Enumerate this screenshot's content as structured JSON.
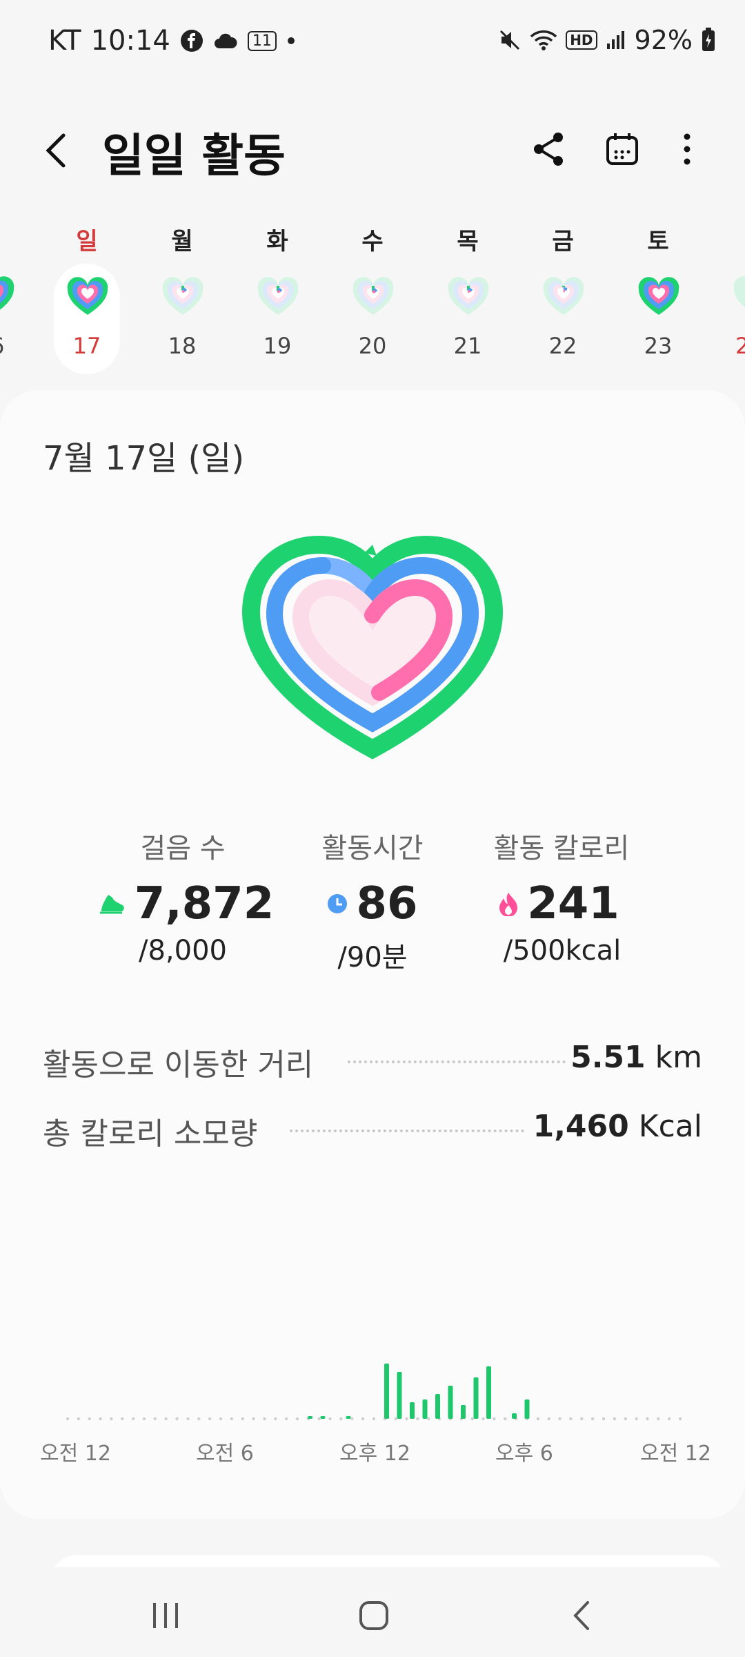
{
  "status_bar": {
    "carrier": "KT",
    "time": "10:14",
    "temperature_badge": "11",
    "battery": "92%",
    "icons": [
      "facebook-icon",
      "cloud-icon",
      "temperature-icon",
      "notification-dot-icon",
      "mute-icon",
      "wifi-icon",
      "hd-voice-icon",
      "signal-icon",
      "battery-charging-icon"
    ]
  },
  "header": {
    "title": "일일 활동",
    "actions": [
      "share-icon",
      "calendar-icon",
      "more-icon"
    ]
  },
  "week": {
    "days": [
      {
        "weekday": "일",
        "date": "17",
        "selected": true,
        "progress": 1.0
      },
      {
        "weekday": "월",
        "date": "18",
        "selected": false,
        "progress": 0.3
      },
      {
        "weekday": "화",
        "date": "19",
        "selected": false,
        "progress": 0.35
      },
      {
        "weekday": "수",
        "date": "20",
        "selected": false,
        "progress": 0.4
      },
      {
        "weekday": "목",
        "date": "21",
        "selected": false,
        "progress": 0.3
      },
      {
        "weekday": "금",
        "date": "22",
        "selected": false,
        "progress": 0.1
      },
      {
        "weekday": "토",
        "date": "23",
        "selected": false,
        "progress": 1.0
      }
    ],
    "prev_partial_date": "6",
    "next_partial_date": "2"
  },
  "card": {
    "date": "7월 17일 (일)",
    "colors": {
      "steps": "#1ed36f",
      "active_time": "#4f9cf5",
      "calories": "#ff6fae"
    },
    "stats": [
      {
        "label": "걸음 수",
        "value": "7,872",
        "goal": "/8,000",
        "icon": "shoe-icon",
        "progress": 0.984
      },
      {
        "label": "활동시간",
        "value": "86",
        "goal": "/90분",
        "icon": "clock-icon",
        "progress": 0.956
      },
      {
        "label": "활동 칼로리",
        "value": "241",
        "goal": "/500kcal",
        "icon": "flame-icon",
        "progress": 0.482
      }
    ],
    "metrics": [
      {
        "label": "활동으로 이동한 거리",
        "value": "5.51",
        "unit": "km"
      },
      {
        "label": "총 칼로리 소모량",
        "value": "1,460",
        "unit": "Kcal"
      }
    ]
  },
  "chart_data": {
    "type": "bar",
    "title": "",
    "xlabel": "",
    "ylabel": "",
    "x_ticks": [
      "오전 12",
      "오전 6",
      "오후 12",
      "오후 6",
      "오전 12"
    ],
    "bars": [
      {
        "hour": 9.5,
        "value": 0.05
      },
      {
        "hour": 10.0,
        "value": 0.05
      },
      {
        "hour": 11.0,
        "value": 0.05
      },
      {
        "hour": 12.5,
        "value": 1.0
      },
      {
        "hour": 13.0,
        "value": 0.85
      },
      {
        "hour": 13.5,
        "value": 0.3
      },
      {
        "hour": 14.0,
        "value": 0.35
      },
      {
        "hour": 14.5,
        "value": 0.45
      },
      {
        "hour": 15.0,
        "value": 0.6
      },
      {
        "hour": 15.5,
        "value": 0.25
      },
      {
        "hour": 16.0,
        "value": 0.75
      },
      {
        "hour": 16.5,
        "value": 0.95
      },
      {
        "hour": 17.5,
        "value": 0.1
      },
      {
        "hour": 18.0,
        "value": 0.35
      }
    ],
    "color": "#1ec66c"
  },
  "nav": {
    "buttons": [
      "recent-apps-icon",
      "home-icon",
      "back-icon"
    ]
  }
}
